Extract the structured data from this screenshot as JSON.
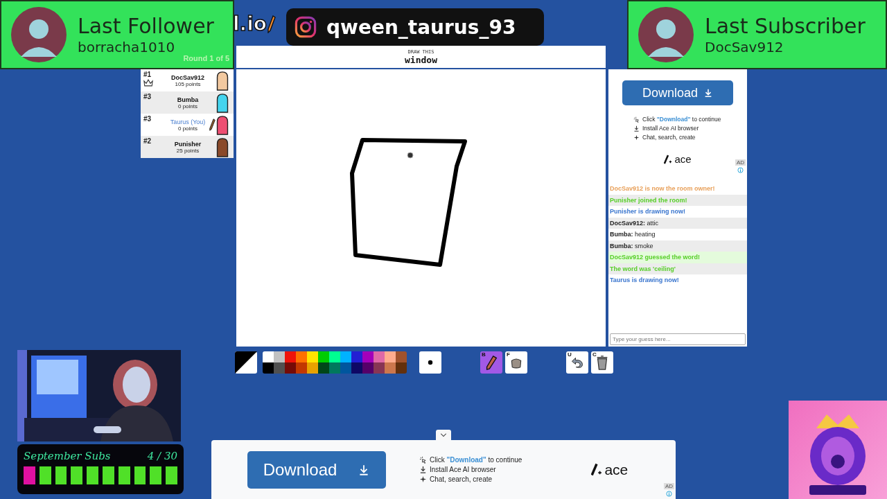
{
  "overlays": {
    "last_follower": {
      "title": "Last Follower",
      "name": "borracha1010"
    },
    "last_subscriber": {
      "title": "Last Subscriber",
      "name": "DocSav912"
    },
    "instagram": {
      "handle": "qween_taurus_93"
    },
    "sub_goal": {
      "title": "September Subs",
      "count": "4 / 30",
      "segments": [
        {
          "filled": true
        },
        {
          "filled": false
        },
        {
          "filled": false
        },
        {
          "filled": false
        },
        {
          "filled": false
        },
        {
          "filled": false
        },
        {
          "filled": false
        },
        {
          "filled": false
        },
        {
          "filled": false
        },
        {
          "filled": false
        }
      ]
    }
  },
  "game": {
    "logo": "l.io",
    "round": "Round 1 of 5",
    "word_hint": "DRAW THIS",
    "word": "window",
    "players": [
      {
        "rank": "#1",
        "name": "DocSav912",
        "points": "105 points",
        "owner": true,
        "you": false,
        "drawing": false,
        "color": "#f2c9a0"
      },
      {
        "rank": "#3",
        "name": "Bumba",
        "points": "0 points",
        "owner": false,
        "you": false,
        "drawing": false,
        "color": "#44d4ee"
      },
      {
        "rank": "#3",
        "name": "Taurus (You)",
        "points": "0 points",
        "owner": false,
        "you": true,
        "drawing": true,
        "color": "#ee4f72"
      },
      {
        "rank": "#2",
        "name": "Punisher",
        "points": "25 points",
        "owner": false,
        "you": false,
        "drawing": false,
        "color": "#8a4a2a"
      }
    ],
    "palette": [
      {
        "color": "#ffffff"
      },
      {
        "color": "#c1c1c1"
      },
      {
        "color": "#ef130b"
      },
      {
        "color": "#ff7100"
      },
      {
        "color": "#ffe400"
      },
      {
        "color": "#00cc00"
      },
      {
        "color": "#00ff91"
      },
      {
        "color": "#00b2ff"
      },
      {
        "color": "#231fd3"
      },
      {
        "color": "#a300ba"
      },
      {
        "color": "#df69a7"
      },
      {
        "color": "#ffac8e"
      },
      {
        "color": "#a0522d"
      },
      {
        "color": "#000000"
      },
      {
        "color": "#505050"
      },
      {
        "color": "#740b07"
      },
      {
        "color": "#c23800"
      },
      {
        "color": "#e8a200"
      },
      {
        "color": "#004619"
      },
      {
        "color": "#00785d"
      },
      {
        "color": "#00569e"
      },
      {
        "color": "#0e0865"
      },
      {
        "color": "#550069"
      },
      {
        "color": "#873554"
      },
      {
        "color": "#cc774d"
      },
      {
        "color": "#63300d"
      }
    ],
    "tools": [
      {
        "key": "B",
        "kind": "brush",
        "selected": true
      },
      {
        "key": "F",
        "kind": "fill",
        "selected": false
      }
    ],
    "actions": [
      {
        "key": "U",
        "kind": "undo"
      },
      {
        "key": "C",
        "kind": "clear"
      }
    ],
    "chat": {
      "messages": [
        {
          "kind": "system",
          "color": "#e8a05a",
          "text": "DocSav912 is now the room owner!"
        },
        {
          "kind": "system",
          "color": "#56ce27",
          "text": "Punisher joined the room!"
        },
        {
          "kind": "system",
          "color": "#3975ce",
          "text": "Punisher is drawing now!"
        },
        {
          "kind": "chat",
          "name": "DocSav912:",
          "text": "attic"
        },
        {
          "kind": "chat",
          "name": "Bumba:",
          "text": "heating"
        },
        {
          "kind": "chat",
          "name": "Bumba:",
          "text": "smoke"
        },
        {
          "kind": "success",
          "color": "#56ce27",
          "text": "DocSav912 guessed the word!"
        },
        {
          "kind": "system",
          "color": "#56ce27",
          "text": "The word was 'ceiling'"
        },
        {
          "kind": "system",
          "color": "#3975ce",
          "text": "Taurus is drawing now!"
        }
      ],
      "placeholder": "Type your guess here..."
    }
  },
  "ads": [
    {
      "button": "Download",
      "lines": [
        {
          "kind": "click",
          "before": "Click",
          "link": "\"Download\"",
          "after": "to continue"
        },
        {
          "kind": "install",
          "text": "Install Ace AI browser"
        },
        {
          "kind": "chat",
          "text": "Chat, search, create"
        }
      ],
      "brand": "ace",
      "badge": "AD"
    },
    {
      "button": "Download",
      "lines": [
        {
          "kind": "click",
          "before": "Click",
          "link": "\"Download\"",
          "after": "to continue"
        },
        {
          "kind": "install",
          "text": "Install Ace AI browser"
        },
        {
          "kind": "chat",
          "text": "Chat, search, create"
        }
      ],
      "brand": "ace",
      "badge": "AD"
    }
  ]
}
